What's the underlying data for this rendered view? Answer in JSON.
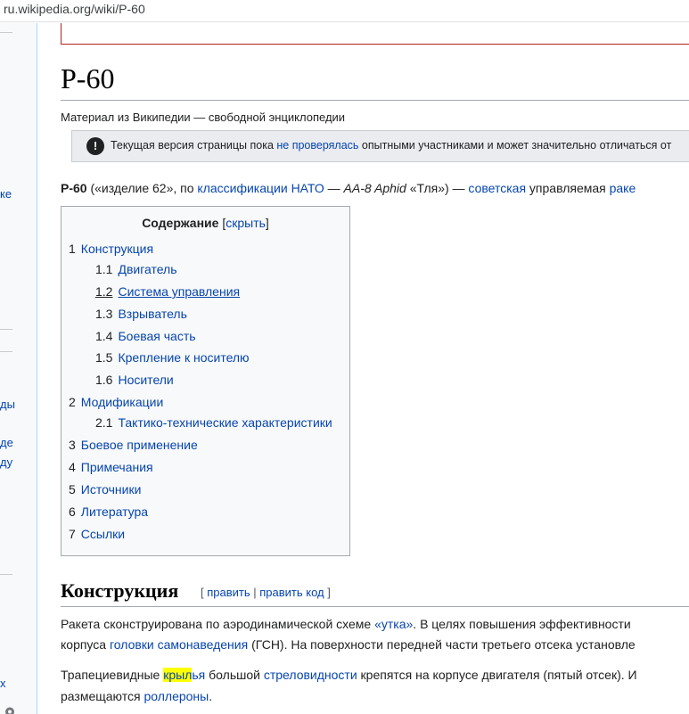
{
  "browser": {
    "url": "ru.wikipedia.org/wiki/P-60"
  },
  "rail": {
    "fragments": [
      "ке",
      "ды",
      "де",
      "ду",
      "х"
    ]
  },
  "article": {
    "title": "Р-60",
    "site_sub": "Материал из Википедии — свободной энциклопедии",
    "flagged": {
      "icon": "info-icon",
      "before": "Текущая версия страницы пока ",
      "link": "не проверялась",
      "after": " опытными участниками и может значительно отличаться от"
    },
    "lead": {
      "bold": "Р-60",
      "t1": " («изделие 62», по ",
      "link1": "классификации НАТО",
      "t2": " — ",
      "italic": "AA-8 Aphid",
      "t3": " «Тля») — ",
      "link2": "советская",
      "t4": " управляемая ",
      "link3": "раке"
    },
    "toc": {
      "title": "Содержание",
      "toggle_open": "[",
      "toggle": "скрыть",
      "toggle_close": "]",
      "items": [
        {
          "num": "1",
          "label": "Конструкция",
          "level": 1
        },
        {
          "num": "1.1",
          "label": "Двигатель",
          "level": 2
        },
        {
          "num": "1.2",
          "label": "Система управления",
          "level": 2
        },
        {
          "num": "1.3",
          "label": "Взрыватель",
          "level": 2
        },
        {
          "num": "1.4",
          "label": "Боевая часть",
          "level": 2
        },
        {
          "num": "1.5",
          "label": "Крепление к носителю",
          "level": 2
        },
        {
          "num": "1.6",
          "label": "Носители",
          "level": 2
        },
        {
          "num": "2",
          "label": "Модификации",
          "level": 1
        },
        {
          "num": "2.1",
          "label": "Тактико-технические характеристики",
          "level": 2
        },
        {
          "num": "3",
          "label": "Боевое применение",
          "level": 1
        },
        {
          "num": "4",
          "label": "Примечания",
          "level": 1
        },
        {
          "num": "5",
          "label": "Источники",
          "level": 1
        },
        {
          "num": "6",
          "label": "Литература",
          "level": 1
        },
        {
          "num": "7",
          "label": "Ссылки",
          "level": 1
        }
      ]
    },
    "section": {
      "heading": "Конструкция",
      "bracket_open": "[ ",
      "edit": "править",
      "sep": " | ",
      "edit_source": "править код",
      "bracket_close": " ]"
    },
    "para1": {
      "l1_t1": "Ракета сконструирована по аэродинамической схеме ",
      "l1_link": "«утка»",
      "l1_t2": ". В целях повышения эффективности",
      "l2_t1": "корпуса ",
      "l2_link": "головки самонаведения",
      "l2_t2": " (ГСН). На поверхности передней части третьего отсека установле"
    },
    "para2": {
      "l1_t1": "Трапециевидные ",
      "l1_hl": "крыл",
      "l1_link_rest": "ья",
      "l1_t2": " большой ",
      "l1_link": "стреловидности",
      "l1_t3": " крепятся на корпусе двигателя (пятый отсек). И",
      "l2_t1": "размещаются ",
      "l2_link": "роллероны",
      "l2_t2": "."
    },
    "colors": {
      "link": "#0645ad",
      "highlight": "#ffff00",
      "notice_border": "#b32424"
    }
  }
}
